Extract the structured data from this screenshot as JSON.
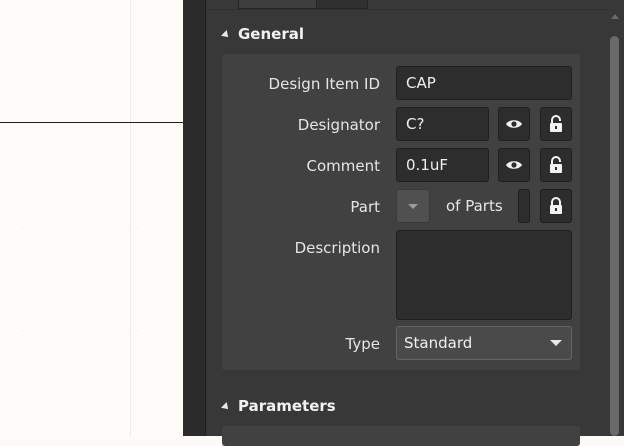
{
  "sections": {
    "general": "General",
    "parameters": "Parameters"
  },
  "general": {
    "design_item_id": {
      "label": "Design Item ID",
      "value": "CAP"
    },
    "designator": {
      "label": "Designator",
      "value": "C?"
    },
    "comment": {
      "label": "Comment",
      "value": "0.1uF"
    },
    "part": {
      "label": "Part",
      "of_parts": "of Parts"
    },
    "description": {
      "label": "Description",
      "value": ""
    },
    "type": {
      "label": "Type",
      "selected": "Standard"
    }
  },
  "icons": {
    "visibility": "eye-icon",
    "lock": "lock-icon",
    "collapse": "collapse-triangle-icon",
    "dropdown": "chevron-down-icon"
  },
  "colors": {
    "panel_bg": "#383838",
    "group_bg": "#414141",
    "field_bg": "#2d2d2d",
    "text": "#e6e6e6"
  }
}
